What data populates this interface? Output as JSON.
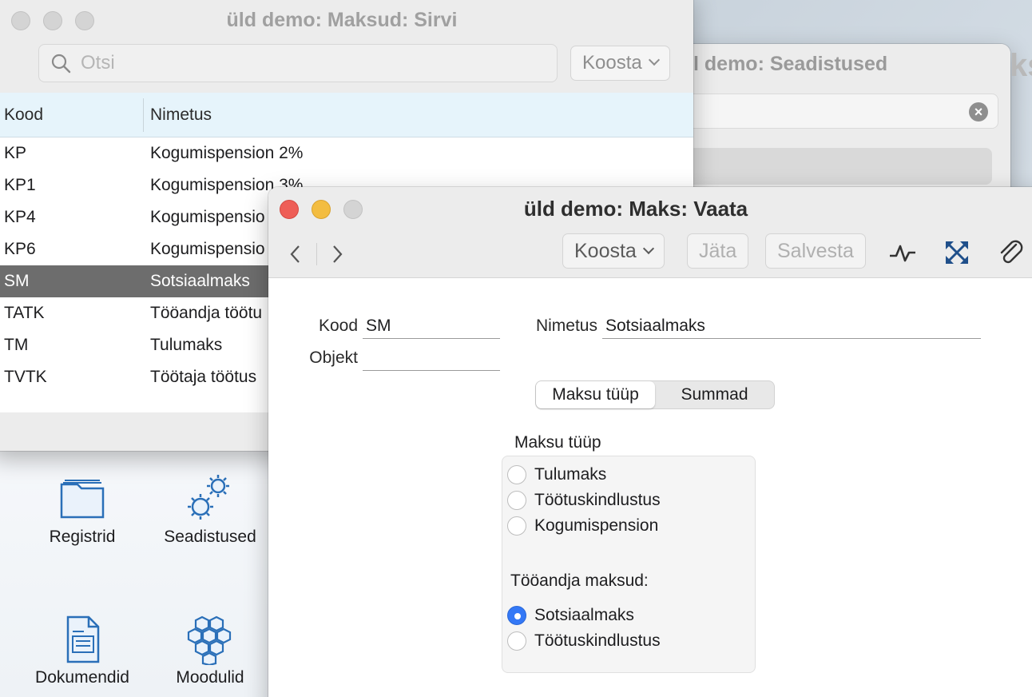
{
  "desktop": {
    "items": [
      {
        "label": "Registrid",
        "icon": "folder-icon"
      },
      {
        "label": "Seadistused",
        "icon": "gears-icon"
      },
      {
        "label": "Dokumendid",
        "icon": "document-icon"
      },
      {
        "label": "Moodulid",
        "icon": "hexagons-icon"
      }
    ],
    "edge_text": "ks"
  },
  "settings_window": {
    "title": "l demo: Seadistused"
  },
  "list_window": {
    "title": "üld demo: Maksud: Sirvi",
    "search_placeholder": "Otsi",
    "koosta_label": "Koosta",
    "columns": [
      "Kood",
      "Nimetus"
    ],
    "rows": [
      {
        "kood": "KP",
        "nimetus": "Kogumispension 2%"
      },
      {
        "kood": "KP1",
        "nimetus": "Kogumispension 3%"
      },
      {
        "kood": "KP4",
        "nimetus": "Kogumispensio"
      },
      {
        "kood": "KP6",
        "nimetus": "Kogumispensio"
      },
      {
        "kood": "SM",
        "nimetus": "Sotsiaalmaks"
      },
      {
        "kood": "TATK",
        "nimetus": "Tööandja töötu"
      },
      {
        "kood": "TM",
        "nimetus": "Tulumaks"
      },
      {
        "kood": "TVTK",
        "nimetus": "Töötaja töötus"
      }
    ],
    "selected_index": 4
  },
  "detail_window": {
    "title": "üld demo: Maks: Vaata",
    "toolbar": {
      "koosta_label": "Koosta",
      "jata_label": "Jäta",
      "salvesta_label": "Salvesta"
    },
    "form": {
      "kood_label": "Kood",
      "kood_value": "SM",
      "nimetus_label": "Nimetus",
      "nimetus_value": "Sotsiaalmaks",
      "objekt_label": "Objekt",
      "objekt_value": ""
    },
    "tabs": [
      "Maksu tüüp",
      "Summad"
    ],
    "active_tab": 0,
    "group_title": "Maksu tüüp",
    "tax_types": [
      "Tulumaks",
      "Töötuskindlustus",
      "Kogumispension"
    ],
    "employer_label": "Tööandja maksud:",
    "employer_taxes": [
      "Sotsiaalmaks",
      "Töötuskindlustus"
    ],
    "selected_employer_tax": "Sotsiaalmaks",
    "colors": {
      "radio_selected": "#3478f6",
      "selected_row": "#6d6d6d",
      "header_bg": "#e6f4fb"
    }
  }
}
